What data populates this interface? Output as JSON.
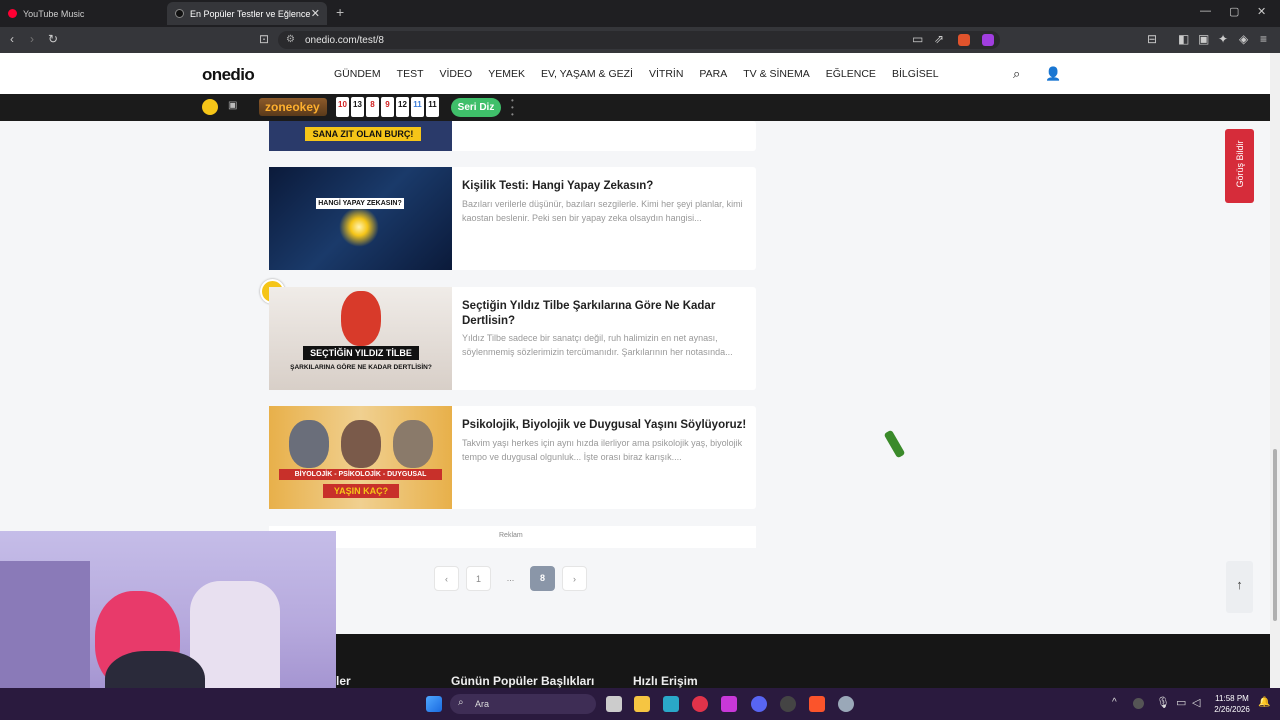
{
  "browser": {
    "tabs": [
      {
        "label": "YouTube Music",
        "favicon_color": "#ff0033"
      },
      {
        "label": "En Popüler Testler ve Eğlenceli O",
        "favicon_color": "#111111"
      }
    ],
    "new_tab": "+",
    "url": "onedio.com/test/8"
  },
  "site": {
    "logo": "onedio",
    "menu": [
      "GÜNDEM",
      "TEST",
      "VİDEO",
      "YEMEK",
      "EV, YAŞAM & GEZİ",
      "VİTRİN",
      "PARA",
      "TV & SİNEMA",
      "EĞLENCE",
      "BİLGİSEL"
    ],
    "zone_label": "zoneokey",
    "tiles": [
      {
        "n": "10",
        "color": "#d02020"
      },
      {
        "n": "13",
        "color": "#111111"
      },
      {
        "n": "8",
        "color": "#d02020"
      },
      {
        "n": "9",
        "color": "#d02020"
      },
      {
        "n": "12",
        "color": "#111111"
      },
      {
        "n": "11",
        "color": "#3a7bd5"
      },
      {
        "n": "11",
        "color": "#111111"
      }
    ],
    "seri_diz": "Seri Diz"
  },
  "cards": [
    {
      "title": "Kişilik Testi: Hangi Yapay Zekasın?",
      "desc": "Bazıları verilerle düşünür, bazıları sezgilerle. Kimi her şeyi planlar, kimi kaostan beslenir. Peki sen bir yapay zeka olsaydın hangisi...",
      "thumb_label": "HANGİ YAPAY ZEKASIN?"
    },
    {
      "title": "Seçtiğin Yıldız Tilbe Şarkılarına Göre Ne Kadar Dertlisin?",
      "desc": "Yıldız Tilbe sadece bir sanatçı değil, ruh halimizin en net aynası, söylenmemiş sözlerimizin tercümanıdır. Şarkılarının her notasında...",
      "thumb_label": "SEÇTİĞİN YILDIZ TİLBE",
      "thumb_sub": "ŞARKILARINA GÖRE NE KADAR DERTLİSİN?"
    },
    {
      "title": "Psikolojik, Biyolojik ve Duygusal Yaşını Söylüyoruz!",
      "desc": "Takvim yaşı herkes için aynı hızda ilerliyor ama psikolojik yaş, biyolojik tempo ve duygusal olgunluk... İşte orası biraz karışık....",
      "thumb_label": "BİYOLOJİK - PSİKOLOJİK - DUYGUSAL",
      "thumb_sub": "YAŞIN KAÇ?"
    }
  ],
  "partial_card_label": "SANA ZIT OLAN BURÇ!",
  "reklam": "Reklam",
  "pagination": {
    "prev": "‹",
    "first": "1",
    "dots": "...",
    "current": "8",
    "next": "›"
  },
  "feedback": "Görüş Bildir",
  "footer": [
    "Günün Popüler Başlıkları",
    "Hızlı Erişim",
    "ler"
  ],
  "taskbar": {
    "search_placeholder": "Ara",
    "time": "11:58 PM",
    "date": "2/26/2026"
  },
  "to_top": "↑"
}
